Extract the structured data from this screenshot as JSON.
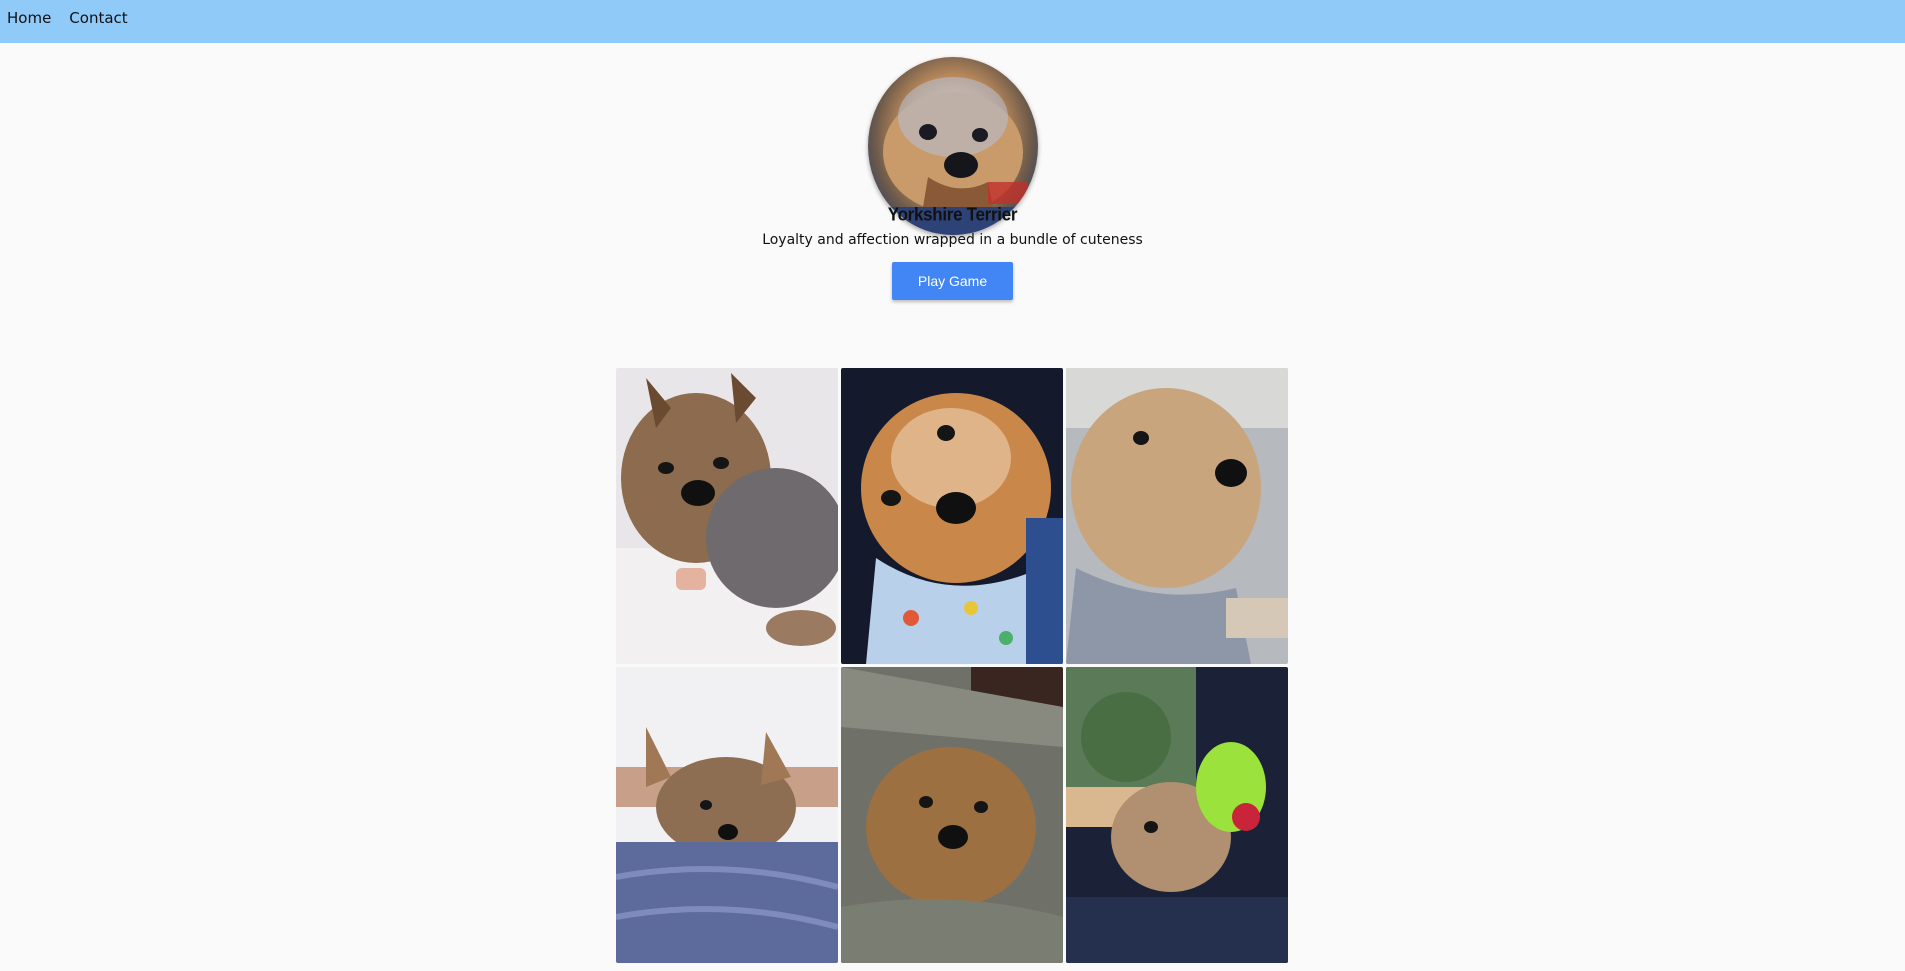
{
  "nav": {
    "items": [
      {
        "label": "Home"
      },
      {
        "label": "Contact"
      }
    ]
  },
  "profile": {
    "title": "Yorkshire Terrier",
    "tagline": "Loyalty and affection wrapped in a bundle of cuteness",
    "play_label": "Play Game"
  },
  "colors": {
    "topbar": "#90caf9",
    "button": "#4285f4",
    "page_bg": "#fafafa"
  },
  "gallery": {
    "count": 6
  }
}
